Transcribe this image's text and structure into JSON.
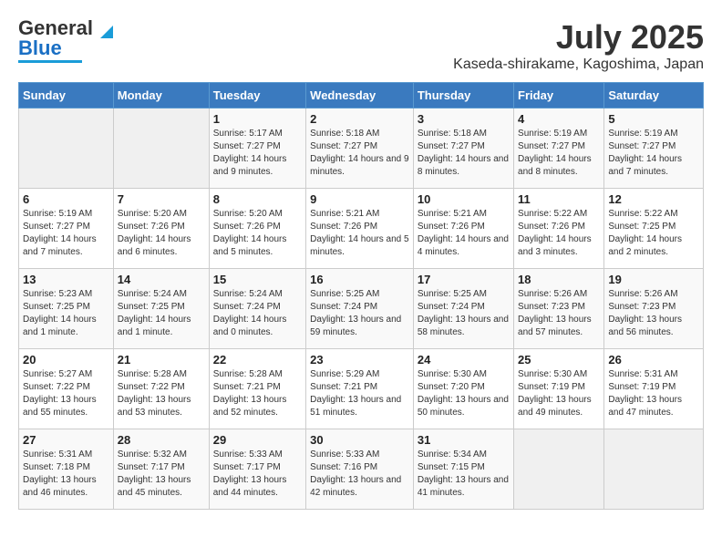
{
  "header": {
    "logo_line1": "General",
    "logo_line2": "Blue",
    "title": "July 2025",
    "subtitle": "Kaseda-shirakame, Kagoshima, Japan"
  },
  "days_of_week": [
    "Sunday",
    "Monday",
    "Tuesday",
    "Wednesday",
    "Thursday",
    "Friday",
    "Saturday"
  ],
  "weeks": [
    [
      {
        "day": "",
        "info": ""
      },
      {
        "day": "",
        "info": ""
      },
      {
        "day": "1",
        "info": "Sunrise: 5:17 AM\nSunset: 7:27 PM\nDaylight: 14 hours and 9 minutes."
      },
      {
        "day": "2",
        "info": "Sunrise: 5:18 AM\nSunset: 7:27 PM\nDaylight: 14 hours and 9 minutes."
      },
      {
        "day": "3",
        "info": "Sunrise: 5:18 AM\nSunset: 7:27 PM\nDaylight: 14 hours and 8 minutes."
      },
      {
        "day": "4",
        "info": "Sunrise: 5:19 AM\nSunset: 7:27 PM\nDaylight: 14 hours and 8 minutes."
      },
      {
        "day": "5",
        "info": "Sunrise: 5:19 AM\nSunset: 7:27 PM\nDaylight: 14 hours and 7 minutes."
      }
    ],
    [
      {
        "day": "6",
        "info": "Sunrise: 5:19 AM\nSunset: 7:27 PM\nDaylight: 14 hours and 7 minutes."
      },
      {
        "day": "7",
        "info": "Sunrise: 5:20 AM\nSunset: 7:26 PM\nDaylight: 14 hours and 6 minutes."
      },
      {
        "day": "8",
        "info": "Sunrise: 5:20 AM\nSunset: 7:26 PM\nDaylight: 14 hours and 5 minutes."
      },
      {
        "day": "9",
        "info": "Sunrise: 5:21 AM\nSunset: 7:26 PM\nDaylight: 14 hours and 5 minutes."
      },
      {
        "day": "10",
        "info": "Sunrise: 5:21 AM\nSunset: 7:26 PM\nDaylight: 14 hours and 4 minutes."
      },
      {
        "day": "11",
        "info": "Sunrise: 5:22 AM\nSunset: 7:26 PM\nDaylight: 14 hours and 3 minutes."
      },
      {
        "day": "12",
        "info": "Sunrise: 5:22 AM\nSunset: 7:25 PM\nDaylight: 14 hours and 2 minutes."
      }
    ],
    [
      {
        "day": "13",
        "info": "Sunrise: 5:23 AM\nSunset: 7:25 PM\nDaylight: 14 hours and 1 minute."
      },
      {
        "day": "14",
        "info": "Sunrise: 5:24 AM\nSunset: 7:25 PM\nDaylight: 14 hours and 1 minute."
      },
      {
        "day": "15",
        "info": "Sunrise: 5:24 AM\nSunset: 7:24 PM\nDaylight: 14 hours and 0 minutes."
      },
      {
        "day": "16",
        "info": "Sunrise: 5:25 AM\nSunset: 7:24 PM\nDaylight: 13 hours and 59 minutes."
      },
      {
        "day": "17",
        "info": "Sunrise: 5:25 AM\nSunset: 7:24 PM\nDaylight: 13 hours and 58 minutes."
      },
      {
        "day": "18",
        "info": "Sunrise: 5:26 AM\nSunset: 7:23 PM\nDaylight: 13 hours and 57 minutes."
      },
      {
        "day": "19",
        "info": "Sunrise: 5:26 AM\nSunset: 7:23 PM\nDaylight: 13 hours and 56 minutes."
      }
    ],
    [
      {
        "day": "20",
        "info": "Sunrise: 5:27 AM\nSunset: 7:22 PM\nDaylight: 13 hours and 55 minutes."
      },
      {
        "day": "21",
        "info": "Sunrise: 5:28 AM\nSunset: 7:22 PM\nDaylight: 13 hours and 53 minutes."
      },
      {
        "day": "22",
        "info": "Sunrise: 5:28 AM\nSunset: 7:21 PM\nDaylight: 13 hours and 52 minutes."
      },
      {
        "day": "23",
        "info": "Sunrise: 5:29 AM\nSunset: 7:21 PM\nDaylight: 13 hours and 51 minutes."
      },
      {
        "day": "24",
        "info": "Sunrise: 5:30 AM\nSunset: 7:20 PM\nDaylight: 13 hours and 50 minutes."
      },
      {
        "day": "25",
        "info": "Sunrise: 5:30 AM\nSunset: 7:19 PM\nDaylight: 13 hours and 49 minutes."
      },
      {
        "day": "26",
        "info": "Sunrise: 5:31 AM\nSunset: 7:19 PM\nDaylight: 13 hours and 47 minutes."
      }
    ],
    [
      {
        "day": "27",
        "info": "Sunrise: 5:31 AM\nSunset: 7:18 PM\nDaylight: 13 hours and 46 minutes."
      },
      {
        "day": "28",
        "info": "Sunrise: 5:32 AM\nSunset: 7:17 PM\nDaylight: 13 hours and 45 minutes."
      },
      {
        "day": "29",
        "info": "Sunrise: 5:33 AM\nSunset: 7:17 PM\nDaylight: 13 hours and 44 minutes."
      },
      {
        "day": "30",
        "info": "Sunrise: 5:33 AM\nSunset: 7:16 PM\nDaylight: 13 hours and 42 minutes."
      },
      {
        "day": "31",
        "info": "Sunrise: 5:34 AM\nSunset: 7:15 PM\nDaylight: 13 hours and 41 minutes."
      },
      {
        "day": "",
        "info": ""
      },
      {
        "day": "",
        "info": ""
      }
    ]
  ]
}
